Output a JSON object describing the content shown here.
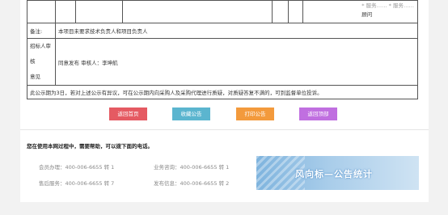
{
  "notice": {
    "top_right_text": "顾问",
    "top_right_fragment": "* 服务…… * 服务……",
    "remark_label": "备注:",
    "remark_value": "本项目未要求技术负责人和项目负责人",
    "review_label_line1": "招标人审核",
    "review_label_line2": "意见",
    "review_value": "同意发布 审核人：李坤航",
    "objection_text": "此公示期为3日，若对上述公示有异议，可在公示期内向采购人及采购代理进行质疑，对质疑答复不满的，可到监督单位投诉。"
  },
  "buttons": [
    {
      "label": "返回首页",
      "color": "#e55a62"
    },
    {
      "label": "收藏公告",
      "color": "#5bb5cf"
    },
    {
      "label": "打印公告",
      "color": "#f39a3c"
    },
    {
      "label": "返回顶部",
      "color": "#c06fe0"
    }
  ],
  "help": {
    "title": "您在使用本网过程中，需要帮助，可以拨下面的电话。",
    "contacts": [
      "会员办理：400-006-6655 转 1",
      "业务咨询：400-006-6655 转 1",
      "售后服务：400-006-6655 转 7",
      "发布信息：400-006-6655 转 2"
    ]
  },
  "banner": {
    "slogan": "风向标—公告统计",
    "background": "#9cc6e8"
  }
}
